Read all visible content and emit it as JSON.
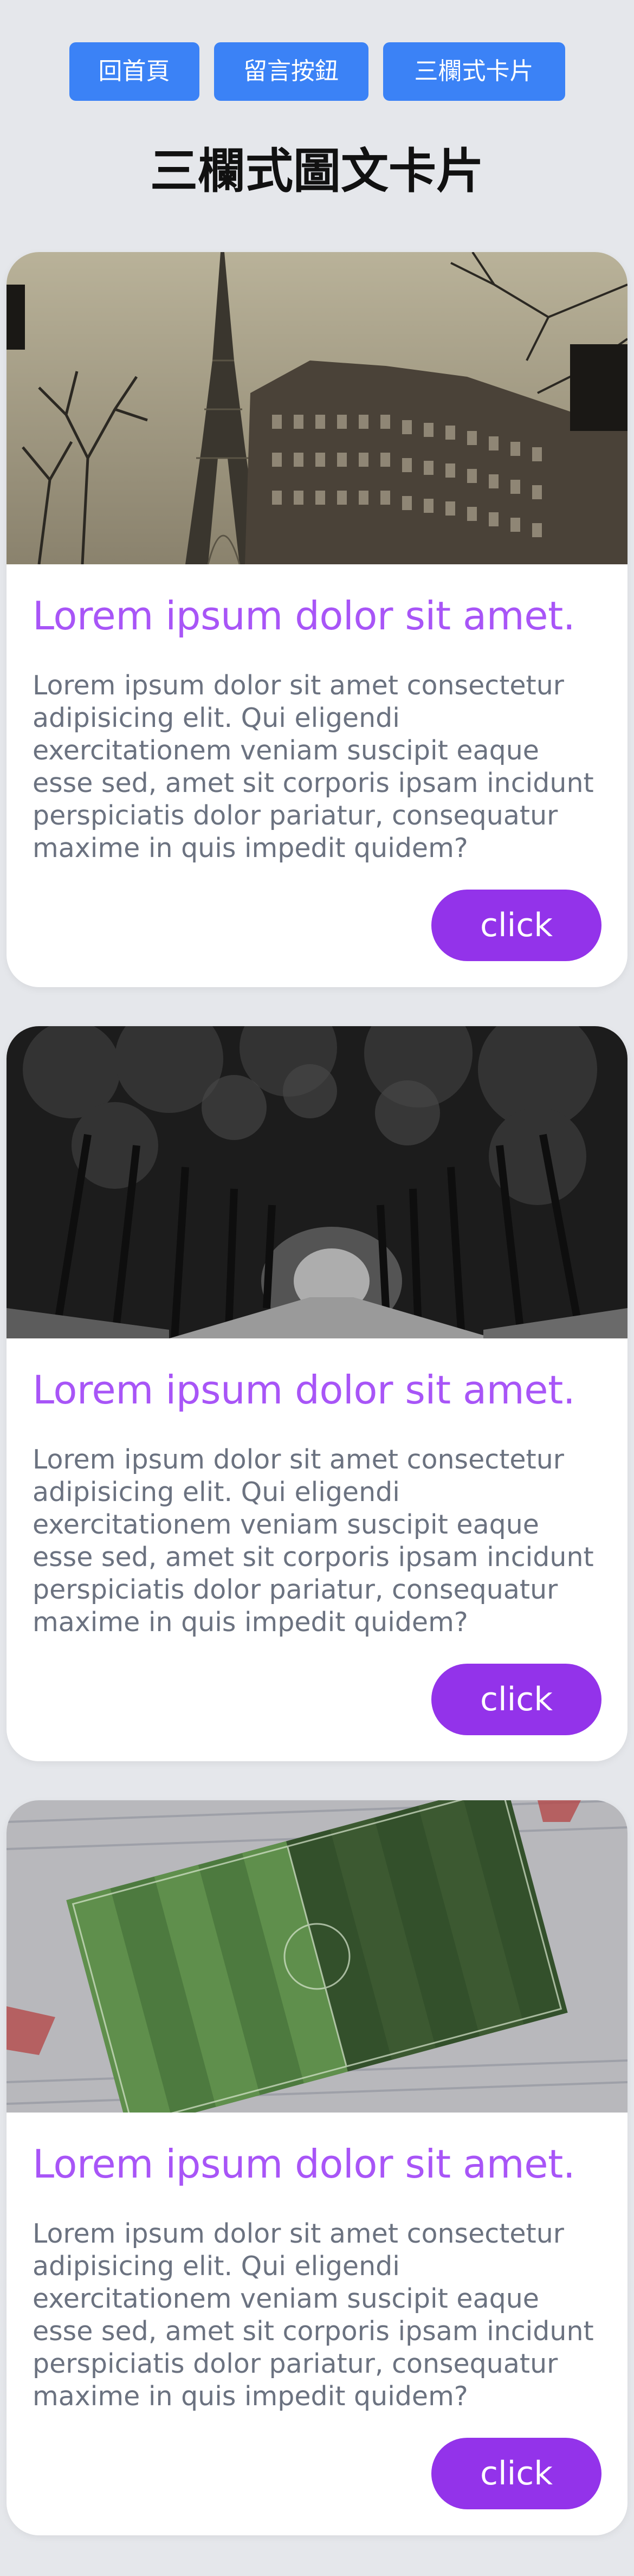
{
  "nav": {
    "home_label": "回首頁",
    "message_label": "留言按鈕",
    "cards_label": "三欄式卡片"
  },
  "page": {
    "title": "三欄式圖文卡片"
  },
  "cards": [
    {
      "title": "Lorem ipsum dolor sit amet.",
      "text": "Lorem ipsum dolor sit amet consectetur adipisicing elit. Qui eligendi exercitationem veniam suscipit eaque esse sed, amet sit corporis ipsam incidunt perspiciatis dolor pariatur, consequatur maxime in quis impedit quidem?",
      "button_label": "click"
    },
    {
      "title": "Lorem ipsum dolor sit amet.",
      "text": "Lorem ipsum dolor sit amet consectetur adipisicing elit. Qui eligendi exercitationem veniam suscipit eaque esse sed, amet sit corporis ipsam incidunt perspiciatis dolor pariatur, consequatur maxime in quis impedit quidem?",
      "button_label": "click"
    },
    {
      "title": "Lorem ipsum dolor sit amet.",
      "text": "Lorem ipsum dolor sit amet consectetur adipisicing elit. Qui eligendi exercitationem veniam suscipit eaque esse sed, amet sit corporis ipsam incidunt perspiciatis dolor pariatur, consequatur maxime in quis impedit quidem?",
      "button_label": "click"
    }
  ],
  "colors": {
    "background": "#e5e7eb",
    "nav_button": "#3b82f6",
    "card_title": "#a855f7",
    "card_text": "#6b7280",
    "card_button": "#9333ea"
  }
}
